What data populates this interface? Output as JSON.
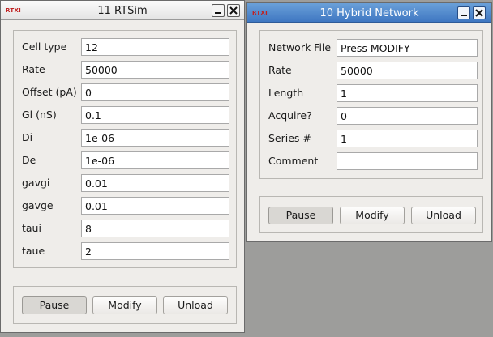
{
  "windows": [
    {
      "logo": "RTXI",
      "title": "11 RTSim",
      "fields": [
        {
          "label": "Cell type",
          "value": "12"
        },
        {
          "label": "Rate",
          "value": "50000"
        },
        {
          "label": "Offset (pA)",
          "value": "0"
        },
        {
          "label": "Gl (nS)",
          "value": "0.1"
        },
        {
          "label": "Di",
          "value": "1e-06"
        },
        {
          "label": "De",
          "value": "1e-06"
        },
        {
          "label": "gavgi",
          "value": "0.01"
        },
        {
          "label": "gavge",
          "value": "0.01"
        },
        {
          "label": "taui",
          "value": "8"
        },
        {
          "label": "taue",
          "value": "2"
        }
      ],
      "buttons": {
        "pause": "Pause",
        "modify": "Modify",
        "unload": "Unload"
      },
      "pause_pressed": true,
      "focused": false
    },
    {
      "logo": "RTXI",
      "title": "10 Hybrid Network",
      "fields": [
        {
          "label": "Network File",
          "value": "Press MODIFY"
        },
        {
          "label": "Rate",
          "value": "50000"
        },
        {
          "label": "Length",
          "value": "1"
        },
        {
          "label": "Acquire?",
          "value": "0"
        },
        {
          "label": "Series #",
          "value": "1"
        },
        {
          "label": "Comment",
          "value": ""
        }
      ],
      "buttons": {
        "pause": "Pause",
        "modify": "Modify",
        "unload": "Unload"
      },
      "pause_pressed": true,
      "focused": true
    }
  ],
  "colors": {
    "desktop": "#9d9d9b",
    "window_bg": "#efedea",
    "active_titlebar": "#4f86cc",
    "logo": "#c02020"
  },
  "icons": {
    "minimize": "minimize-icon",
    "close": "close-icon"
  }
}
